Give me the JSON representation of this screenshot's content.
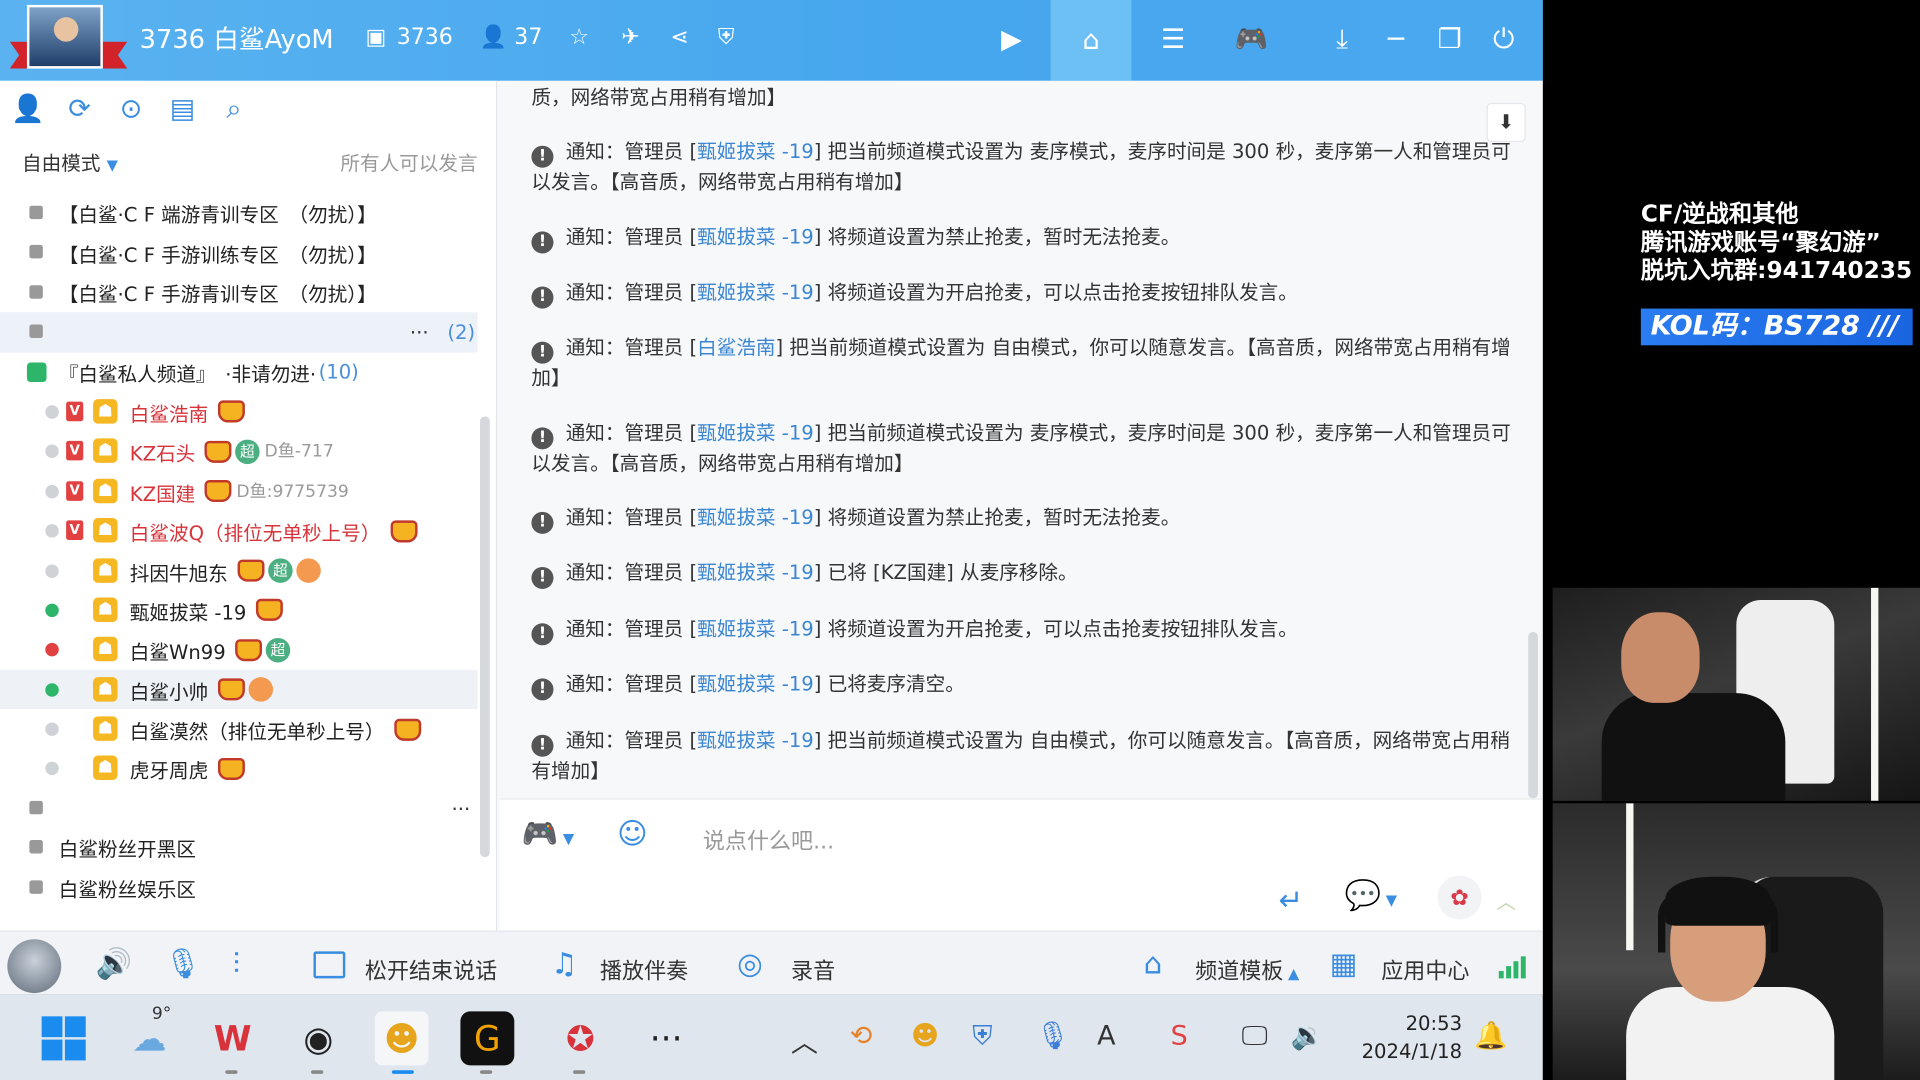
{
  "titlebar": {
    "title": "3736 白鲨AyoM",
    "id_label": "3736",
    "online_count": "37",
    "accent": "#46a6ee"
  },
  "left": {
    "mode": "自由模式",
    "mode_right": "所有人可以发言",
    "channels_top": [
      "【白鲨·C F 端游青训专区　（勿扰）】",
      "【白鲨·C F 手游训练专区　（勿扰）】",
      "【白鲨·C F 手游青训专区　（勿扰）】"
    ],
    "collapsed_more": "···",
    "collapsed_count": "(2)",
    "group_name": "『白鲨私人频道』　·非请勿进·",
    "group_count": "(10)",
    "users": [
      {
        "name": "白鲨浩南",
        "extra": "",
        "color": "red",
        "status": "gray",
        "v": true
      },
      {
        "name": "KZ石头",
        "extra": "D鱼-717",
        "color": "red",
        "status": "gray",
        "v": true
      },
      {
        "name": "KZ国建",
        "extra": "D鱼:9775739",
        "color": "red",
        "status": "gray",
        "v": true
      },
      {
        "name": "白鲨波Q（排位无单秒上号）",
        "extra": "",
        "color": "red",
        "status": "gray",
        "v": true
      },
      {
        "name": "抖因牛旭东",
        "extra": "",
        "color": "dark",
        "status": "gray",
        "v": false
      },
      {
        "name": "甄姬拔菜 -19",
        "extra": "",
        "color": "dark",
        "status": "green",
        "v": false
      },
      {
        "name": "白鲨Wn99",
        "extra": "",
        "color": "dark",
        "status": "red",
        "v": false
      },
      {
        "name": "白鲨小帅",
        "extra": "",
        "color": "dark",
        "status": "green",
        "v": false
      },
      {
        "name": "白鲨漠然（排位无单秒上号）",
        "extra": "",
        "color": "dark",
        "status": "gray",
        "v": false
      },
      {
        "name": "虎牙周虎",
        "extra": "",
        "color": "dark",
        "status": "gray",
        "v": false
      }
    ],
    "channels_bottom": [
      "白鲨粉丝开黑区",
      "白鲨粉丝娱乐区"
    ],
    "badge_chao": "超"
  },
  "chat": {
    "notice_prefix": "通知：管理员",
    "messages": [
      {
        "top": "top-partial",
        "who": "",
        "text": "质，网络带宽占用稍有增加】"
      },
      {
        "who": "甄姬拔菜 -19",
        "text": "把当前频道模式设置为 麦序模式，麦序时间是 300 秒，麦序第一人和管理员可以发言。【高音质，网络带宽占用稍有增加】"
      },
      {
        "who": "甄姬拔菜 -19",
        "text": "将频道设置为禁止抢麦，暂时无法抢麦。"
      },
      {
        "who": "甄姬拔菜 -19",
        "text": "将频道设置为开启抢麦，可以点击抢麦按钮排队发言。"
      },
      {
        "who": "白鲨浩南",
        "text": "把当前频道模式设置为 自由模式，你可以随意发言。【高音质，网络带宽占用稍有增加】"
      },
      {
        "who": "甄姬拔菜 -19",
        "text": "把当前频道模式设置为 麦序模式，麦序时间是 300 秒，麦序第一人和管理员可以发言。【高音质，网络带宽占用稍有增加】"
      },
      {
        "who": "甄姬拔菜 -19",
        "text": "将频道设置为禁止抢麦，暂时无法抢麦。"
      },
      {
        "who": "甄姬拔菜 -19",
        "text": "已将 [KZ国建] 从麦序移除。"
      },
      {
        "who": "甄姬拔菜 -19",
        "text": "将频道设置为开启抢麦，可以点击抢麦按钮排队发言。"
      },
      {
        "who": "甄姬拔菜 -19",
        "text": "已将麦序清空。"
      },
      {
        "who": "甄姬拔菜 -19",
        "text": "把当前频道模式设置为 自由模式，你可以随意发言。【高音质，网络带宽占用稍有增加】"
      }
    ]
  },
  "input": {
    "placeholder": "说点什么吧..."
  },
  "bottombar": {
    "release_label": "松开结束说话",
    "music_label": "播放伴奏",
    "record_label": "录音",
    "template_label": "频道模板",
    "app_center_label": "应用中心"
  },
  "taskbar": {
    "temperature": "9°",
    "time": "20:53",
    "date": "2024/1/18"
  },
  "overlay": {
    "line1": "CF/逆战和其他",
    "line2": "腾讯游戏账号“聚幻游”",
    "line3": "脱坑入坑群:941740235",
    "kol": "KOL码：BS728 ///"
  }
}
